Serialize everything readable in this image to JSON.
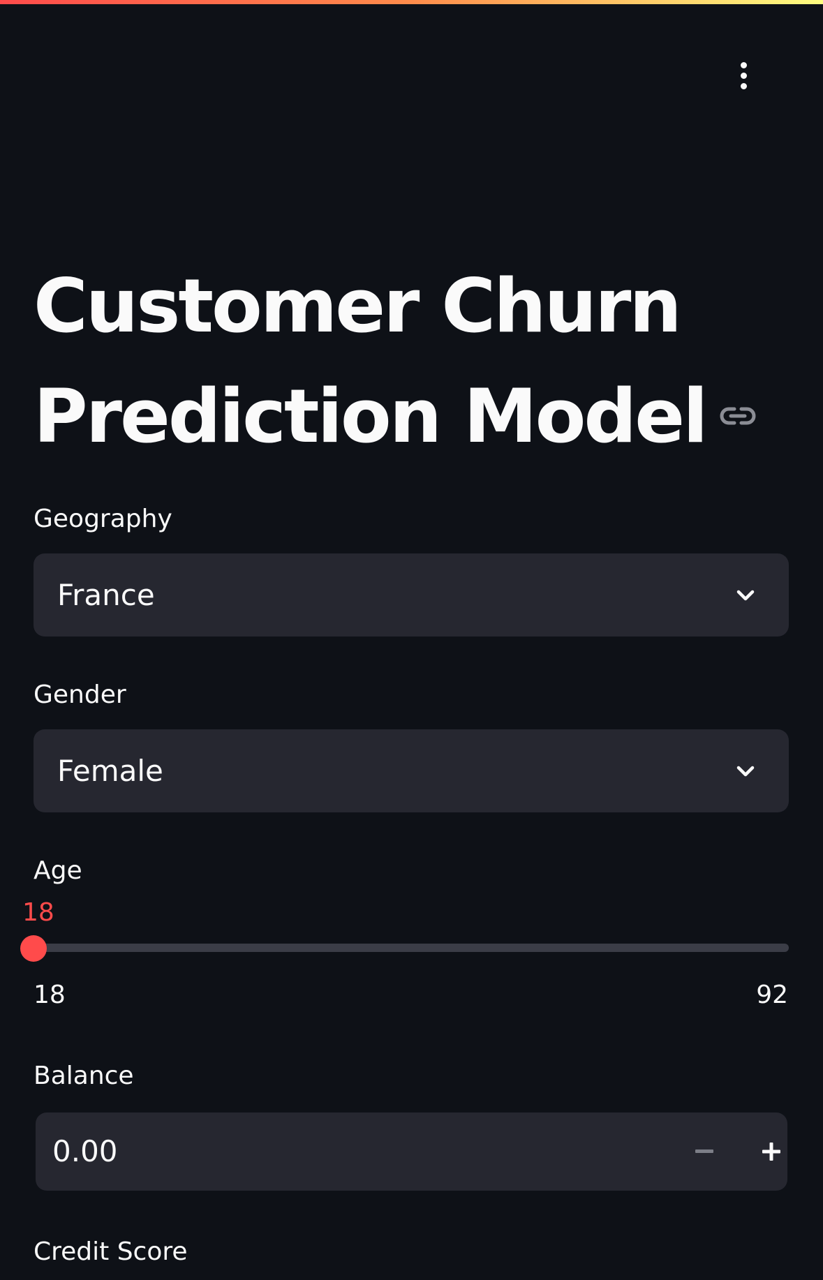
{
  "app": {
    "title": "Customer Churn Prediction Model"
  },
  "icons": {
    "menu": "vertical-ellipsis-icon",
    "anchor_link": "link-icon",
    "dropdown": "chevron-down-icon",
    "minus": "minus-icon",
    "plus": "plus-icon"
  },
  "colors": {
    "background": "#0e1117",
    "widget_background": "#262730",
    "accent": "#ff4b4b",
    "text": "#fafafa"
  },
  "form": {
    "geography": {
      "label": "Geography",
      "selected": "France"
    },
    "gender": {
      "label": "Gender",
      "selected": "Female"
    },
    "age": {
      "label": "Age",
      "value": "18",
      "min": "18",
      "max": "92"
    },
    "balance": {
      "label": "Balance",
      "value": "0.00"
    },
    "credit_score": {
      "label": "Credit Score"
    }
  }
}
